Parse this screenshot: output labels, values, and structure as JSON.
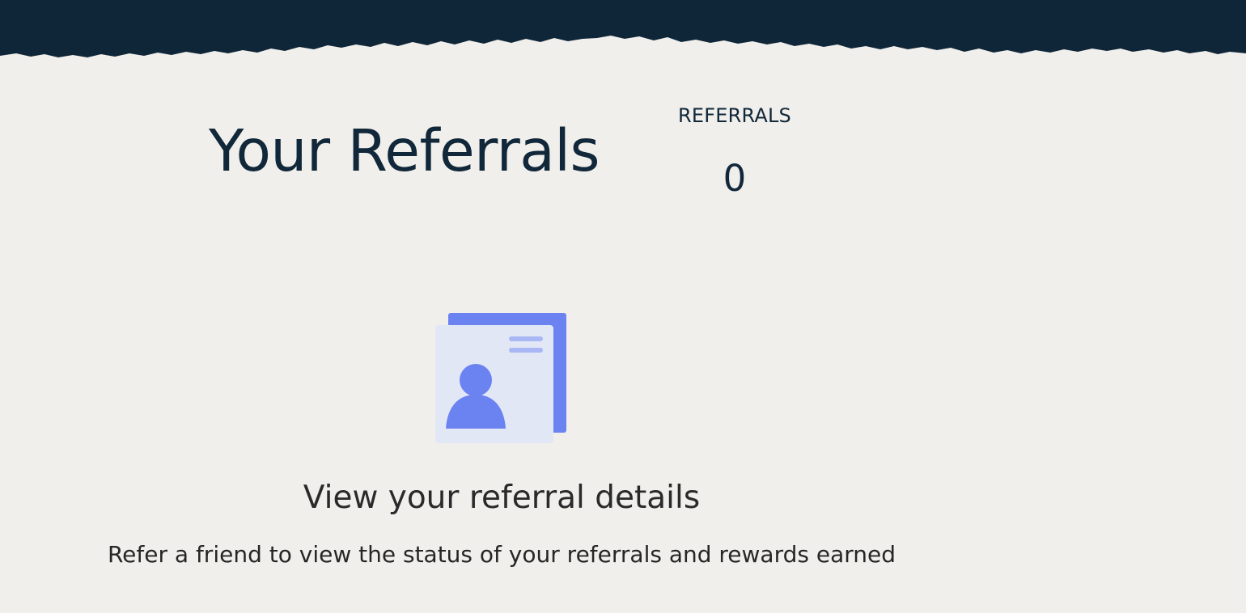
{
  "header": {
    "band_color": "#0f2638",
    "page_bg": "#f0efeb"
  },
  "title": "Your Referrals",
  "stats": {
    "label": "REFERRALS",
    "value": "0"
  },
  "empty_state": {
    "icon": "contact-card-icon",
    "heading": "View your referral details",
    "message": "Refer a friend to view the status of your referrals and rewards earned",
    "accent_color": "#6b82f1",
    "card_color": "#e2e7f6"
  }
}
